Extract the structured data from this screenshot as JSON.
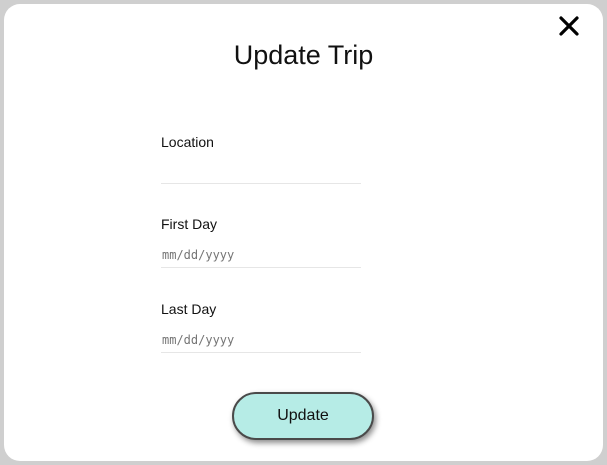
{
  "dialog": {
    "title": "Update Trip",
    "close_icon": "close-icon",
    "fields": {
      "location": {
        "label": "Location",
        "value": "",
        "placeholder": ""
      },
      "first_day": {
        "label": "First Day",
        "value": "",
        "placeholder": "mm/dd/yyyy"
      },
      "last_day": {
        "label": "Last Day",
        "value": "",
        "placeholder": "mm/dd/yyyy"
      }
    },
    "submit_label": "Update",
    "colors": {
      "button_background": "#b6ece6",
      "backdrop": "#cfcfcf"
    }
  }
}
